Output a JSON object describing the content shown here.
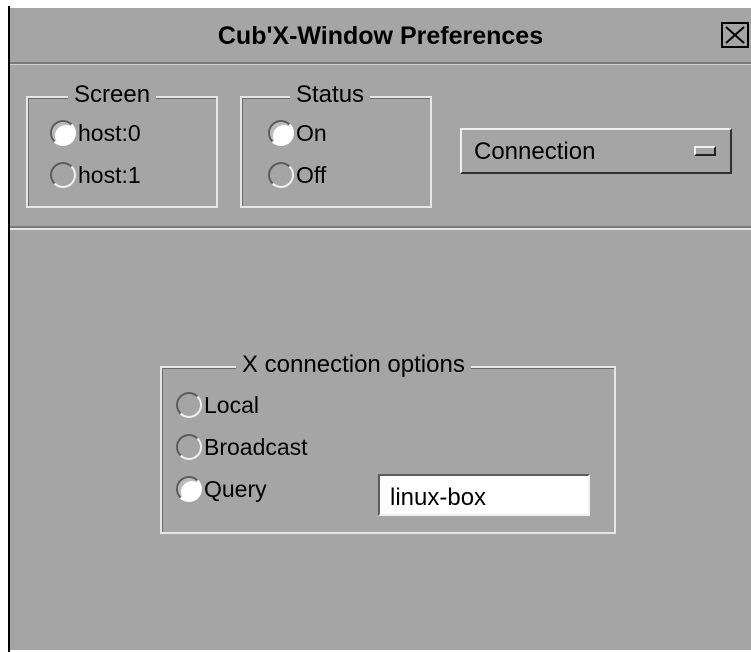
{
  "window": {
    "title": "Cub'X-Window Preferences"
  },
  "screen": {
    "label": "Screen",
    "options": [
      "host:0",
      "host:1"
    ],
    "selected": "host:0"
  },
  "status": {
    "label": "Status",
    "options": [
      "On",
      "Off"
    ],
    "selected": "On"
  },
  "category_menu": {
    "value": "Connection"
  },
  "connection": {
    "label": "X connection options",
    "options": [
      "Local",
      "Broadcast",
      "Query"
    ],
    "selected": "Query",
    "query_host": "linux-box"
  },
  "colors": {
    "background": "#a5a5a5",
    "field": "#ffffff"
  },
  "icons": {
    "close": "close-icon",
    "menu_indicator": "option-menu-indicator-icon"
  }
}
